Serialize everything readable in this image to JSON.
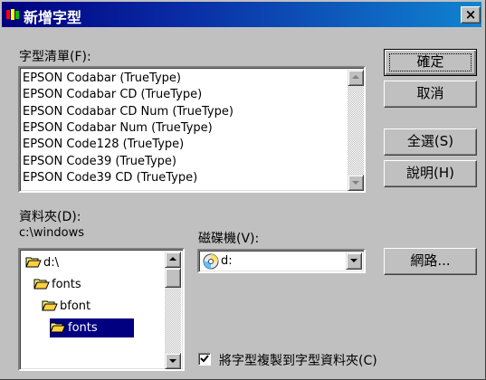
{
  "window": {
    "title": "新增字型",
    "close_glyph": "×"
  },
  "font_list": {
    "label": "字型清單(F):",
    "items": [
      "EPSON Codabar (TrueType)",
      "EPSON Codabar CD (TrueType)",
      "EPSON Codabar CD Num (TrueType)",
      "EPSON Codabar Num (TrueType)",
      "EPSON Code128 (TrueType)",
      "EPSON Code39 (TrueType)",
      "EPSON Code39 CD (TrueType)"
    ]
  },
  "buttons": {
    "ok": "確定",
    "cancel": "取消",
    "select_all": "全選(S)",
    "help": "說明(H)",
    "network": "網路..."
  },
  "folders": {
    "label": "資料夾(D):",
    "current_path": "c:\\windows",
    "items": [
      {
        "label": "d:\\",
        "level": 0,
        "icon": "open-folder-icon"
      },
      {
        "label": "fonts",
        "level": 1,
        "icon": "open-folder-icon"
      },
      {
        "label": "bfont",
        "level": 2,
        "icon": "open-folder-icon"
      },
      {
        "label": "fonts",
        "level": 3,
        "icon": "open-folder-icon",
        "selected": true
      }
    ]
  },
  "drives": {
    "label": "磁碟機(V):",
    "selected": "d:",
    "icon": "cd-drive-icon"
  },
  "copy_option": {
    "label": "將字型複製到字型資料夾(C)",
    "checked": true
  },
  "colors": {
    "title_bar_start": "#000080",
    "title_bar_end": "#1084d0",
    "dialog_face": "#c0c0c0",
    "selection": "#000080"
  }
}
